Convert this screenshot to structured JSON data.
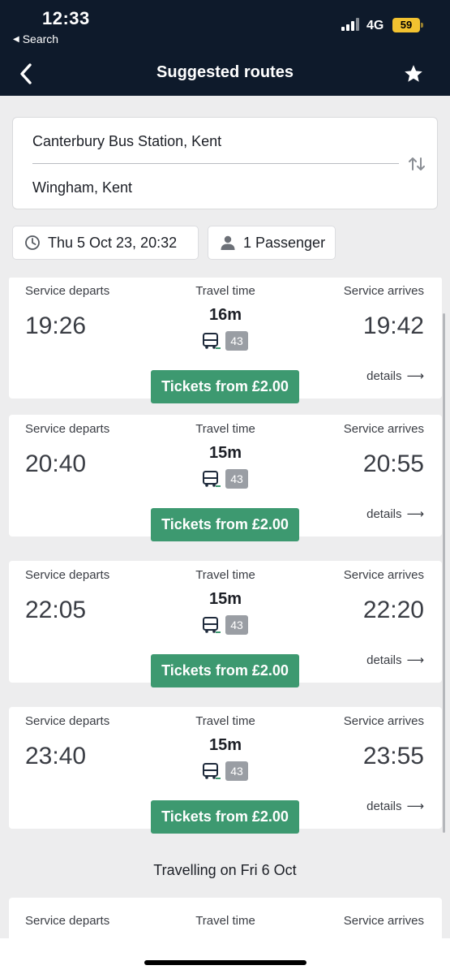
{
  "status_bar": {
    "time": "12:33",
    "back_app": "Search",
    "network": "4G",
    "battery": "59"
  },
  "header": {
    "title": "Suggested routes"
  },
  "route": {
    "from": "Canterbury Bus Station, Kent",
    "to": "Wingham, Kent"
  },
  "filters": {
    "date": "Thu 5 Oct 23, 20:32",
    "passengers": "1 Passenger"
  },
  "labels": {
    "departs": "Service departs",
    "travel_time": "Travel time",
    "arrives": "Service arrives",
    "details": "details",
    "tickets": "Tickets from £2.00"
  },
  "journeys": [
    {
      "departs": "19:26",
      "arrives": "19:42",
      "duration": "16m",
      "route": "43"
    },
    {
      "departs": "20:40",
      "arrives": "20:55",
      "duration": "15m",
      "route": "43"
    },
    {
      "departs": "22:05",
      "arrives": "22:20",
      "duration": "15m",
      "route": "43"
    },
    {
      "departs": "23:40",
      "arrives": "23:55",
      "duration": "15m",
      "route": "43"
    }
  ],
  "next_day_header": "Travelling on Fri 6 Oct",
  "colors": {
    "header_bg": "#0e1a2b",
    "tickets_green": "#3d9970",
    "route_badge": "#9a9ea4",
    "battery_yellow": "#f2c230"
  }
}
